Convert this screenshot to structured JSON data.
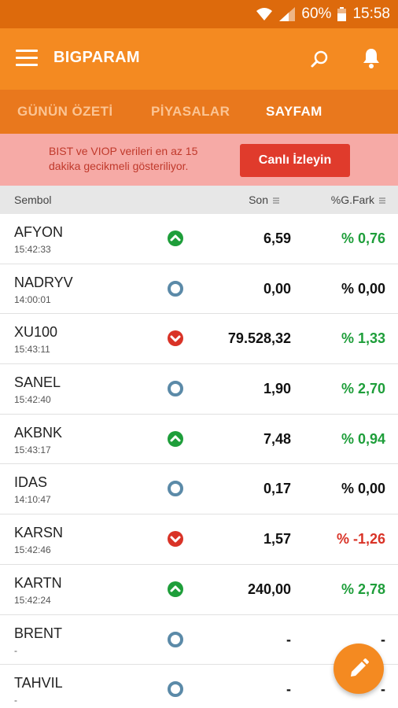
{
  "status_bar": {
    "battery": "60%",
    "time": "15:58"
  },
  "app_bar": {
    "title": "BIGPARAM",
    "menu_icon": "hamburger-menu-icon",
    "search_icon": "search-icon",
    "notification_icon": "bell-icon"
  },
  "tabs": [
    {
      "label": "GÜNÜN ÖZETİ",
      "active": false
    },
    {
      "label": "PİYASALAR",
      "active": false
    },
    {
      "label": "SAYFAM",
      "active": true
    }
  ],
  "notice": {
    "text": "BIST ve VIOP verileri en az 15 dakika gecikmeli gösteriliyor.",
    "button_label": "Canlı İzleyin"
  },
  "table": {
    "headers": {
      "symbol": "Sembol",
      "last": "Son",
      "change": "%G.Fark"
    },
    "rows": [
      {
        "symbol": "AFYON",
        "time": "15:42:33",
        "status": "up",
        "last": "6,59",
        "change": "% 0,76",
        "change_color": "green"
      },
      {
        "symbol": "NADRYV",
        "time": "14:00:01",
        "status": "neutral",
        "last": "0,00",
        "change": "% 0,00",
        "change_color": "black"
      },
      {
        "symbol": "XU100",
        "time": "15:43:11",
        "status": "down",
        "last": "79.528,32",
        "change": "% 1,33",
        "change_color": "green"
      },
      {
        "symbol": "SANEL",
        "time": "15:42:40",
        "status": "neutral",
        "last": "1,90",
        "change": "% 2,70",
        "change_color": "green"
      },
      {
        "symbol": "AKBNK",
        "time": "15:43:17",
        "status": "up",
        "last": "7,48",
        "change": "% 0,94",
        "change_color": "green"
      },
      {
        "symbol": "IDAS",
        "time": "14:10:47",
        "status": "neutral",
        "last": "0,17",
        "change": "% 0,00",
        "change_color": "black"
      },
      {
        "symbol": "KARSN",
        "time": "15:42:46",
        "status": "down",
        "last": "1,57",
        "change": "% -1,26",
        "change_color": "red"
      },
      {
        "symbol": "KARTN",
        "time": "15:42:24",
        "status": "up",
        "last": "240,00",
        "change": "% 2,78",
        "change_color": "green"
      },
      {
        "symbol": "BRENT",
        "time": "-",
        "status": "neutral",
        "last": "-",
        "change": "-",
        "change_color": "black"
      },
      {
        "symbol": "TAHVIL",
        "time": "-",
        "status": "neutral",
        "last": "-",
        "change": "-",
        "change_color": "black"
      }
    ]
  },
  "fab": {
    "icon": "pencil-edit-icon"
  },
  "colors": {
    "status_bar": "#dd6a0c",
    "app_bar": "#f48a21",
    "tabs_bar": "#e9781d",
    "notice_bg": "#f6aaa6",
    "live_button": "#e03b2c",
    "up": "#1e9e3a",
    "down": "#d93327",
    "neutral": "#5b8aa8",
    "green_text": "#1e9e3a",
    "red_text": "#d93327"
  }
}
